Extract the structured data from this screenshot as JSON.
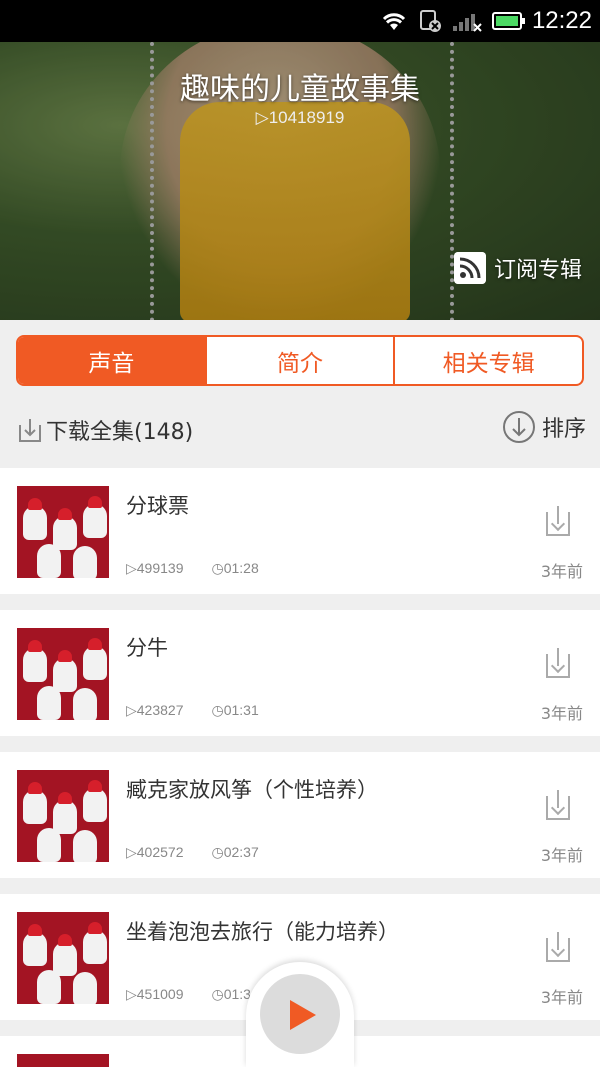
{
  "status_bar": {
    "time": "12:22"
  },
  "header": {
    "title": "趣味的儿童故事集",
    "play_count": "▷10418919",
    "subscribe_label": "订阅专辑"
  },
  "tabs": [
    {
      "label": "声音",
      "active": true
    },
    {
      "label": "简介",
      "active": false
    },
    {
      "label": "相关专辑",
      "active": false
    }
  ],
  "toolbar": {
    "download_all_label": "下载全集(148)",
    "sort_label": "排序"
  },
  "tracks": [
    {
      "title": "分球票",
      "plays": "▷499139",
      "duration": "◷01:28",
      "ago": "3年前"
    },
    {
      "title": "分牛",
      "plays": "▷423827",
      "duration": "◷01:31",
      "ago": "3年前"
    },
    {
      "title": "臧克家放风筝（个性培养）",
      "plays": "▷402572",
      "duration": "◷02:37",
      "ago": "3年前"
    },
    {
      "title": "坐着泡泡去旅行（能力培养）",
      "plays": "▷451009",
      "duration": "◷01:3",
      "ago": "3年前"
    }
  ],
  "colors": {
    "accent": "#f05a24",
    "background": "#efefef"
  }
}
